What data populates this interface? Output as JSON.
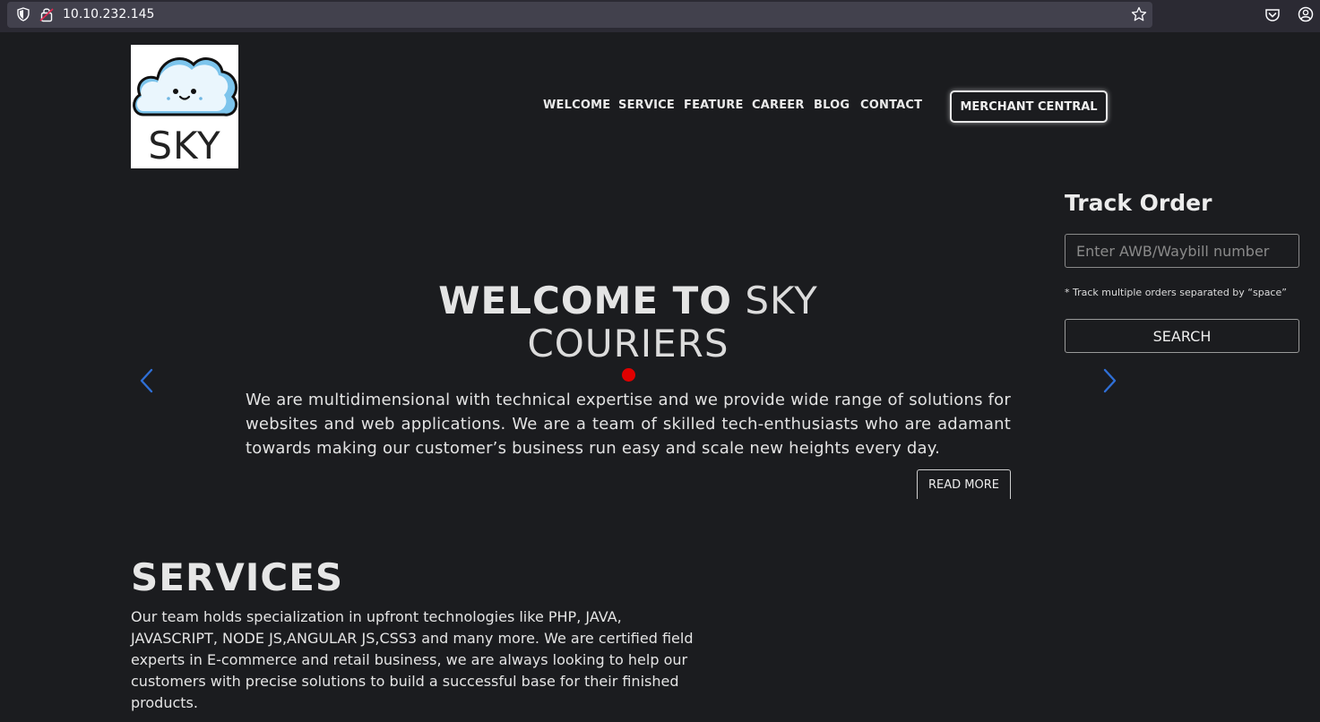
{
  "browser": {
    "url": "10.10.232.145"
  },
  "logo": {
    "text": "SKY"
  },
  "nav": {
    "items": [
      {
        "label": "WELCOME"
      },
      {
        "label": "SERVICE"
      },
      {
        "label": "FEATURE"
      },
      {
        "label": "CAREER"
      },
      {
        "label": "BLOG"
      },
      {
        "label": "CONTACT"
      }
    ],
    "merchant_button": "MERCHANT CENTRAL"
  },
  "hero": {
    "title_bold": "WELCOME TO",
    "title_light_1": "SKY",
    "title_light_2": "COURIERS",
    "text": "We are multidimensional with technical expertise and we provide wide range of solutions for websites and web applications. We are a team of skilled tech-enthusiasts who are adamant towards making our customer’s business run easy and scale new heights every day.",
    "read_more": "READ MORE"
  },
  "track": {
    "title": "Track Order",
    "placeholder": "Enter AWB/Waybill number",
    "note": "* Track multiple orders separated by “space”",
    "search_label": "SEARCH"
  },
  "services": {
    "title": "SERVICES",
    "text": "Our team holds specialization in upfront technologies like PHP, JAVA, JAVASCRIPT, NODE JS,ANGULAR JS,CSS3 and many more. We are certified field experts in E-commerce and retail business, we are always looking to help our customers with precise solutions to build a successful base for their finished products."
  },
  "colors": {
    "background": "#1b1c1f",
    "accent_red": "#e00000",
    "arrow_blue": "#2f6fd6"
  }
}
